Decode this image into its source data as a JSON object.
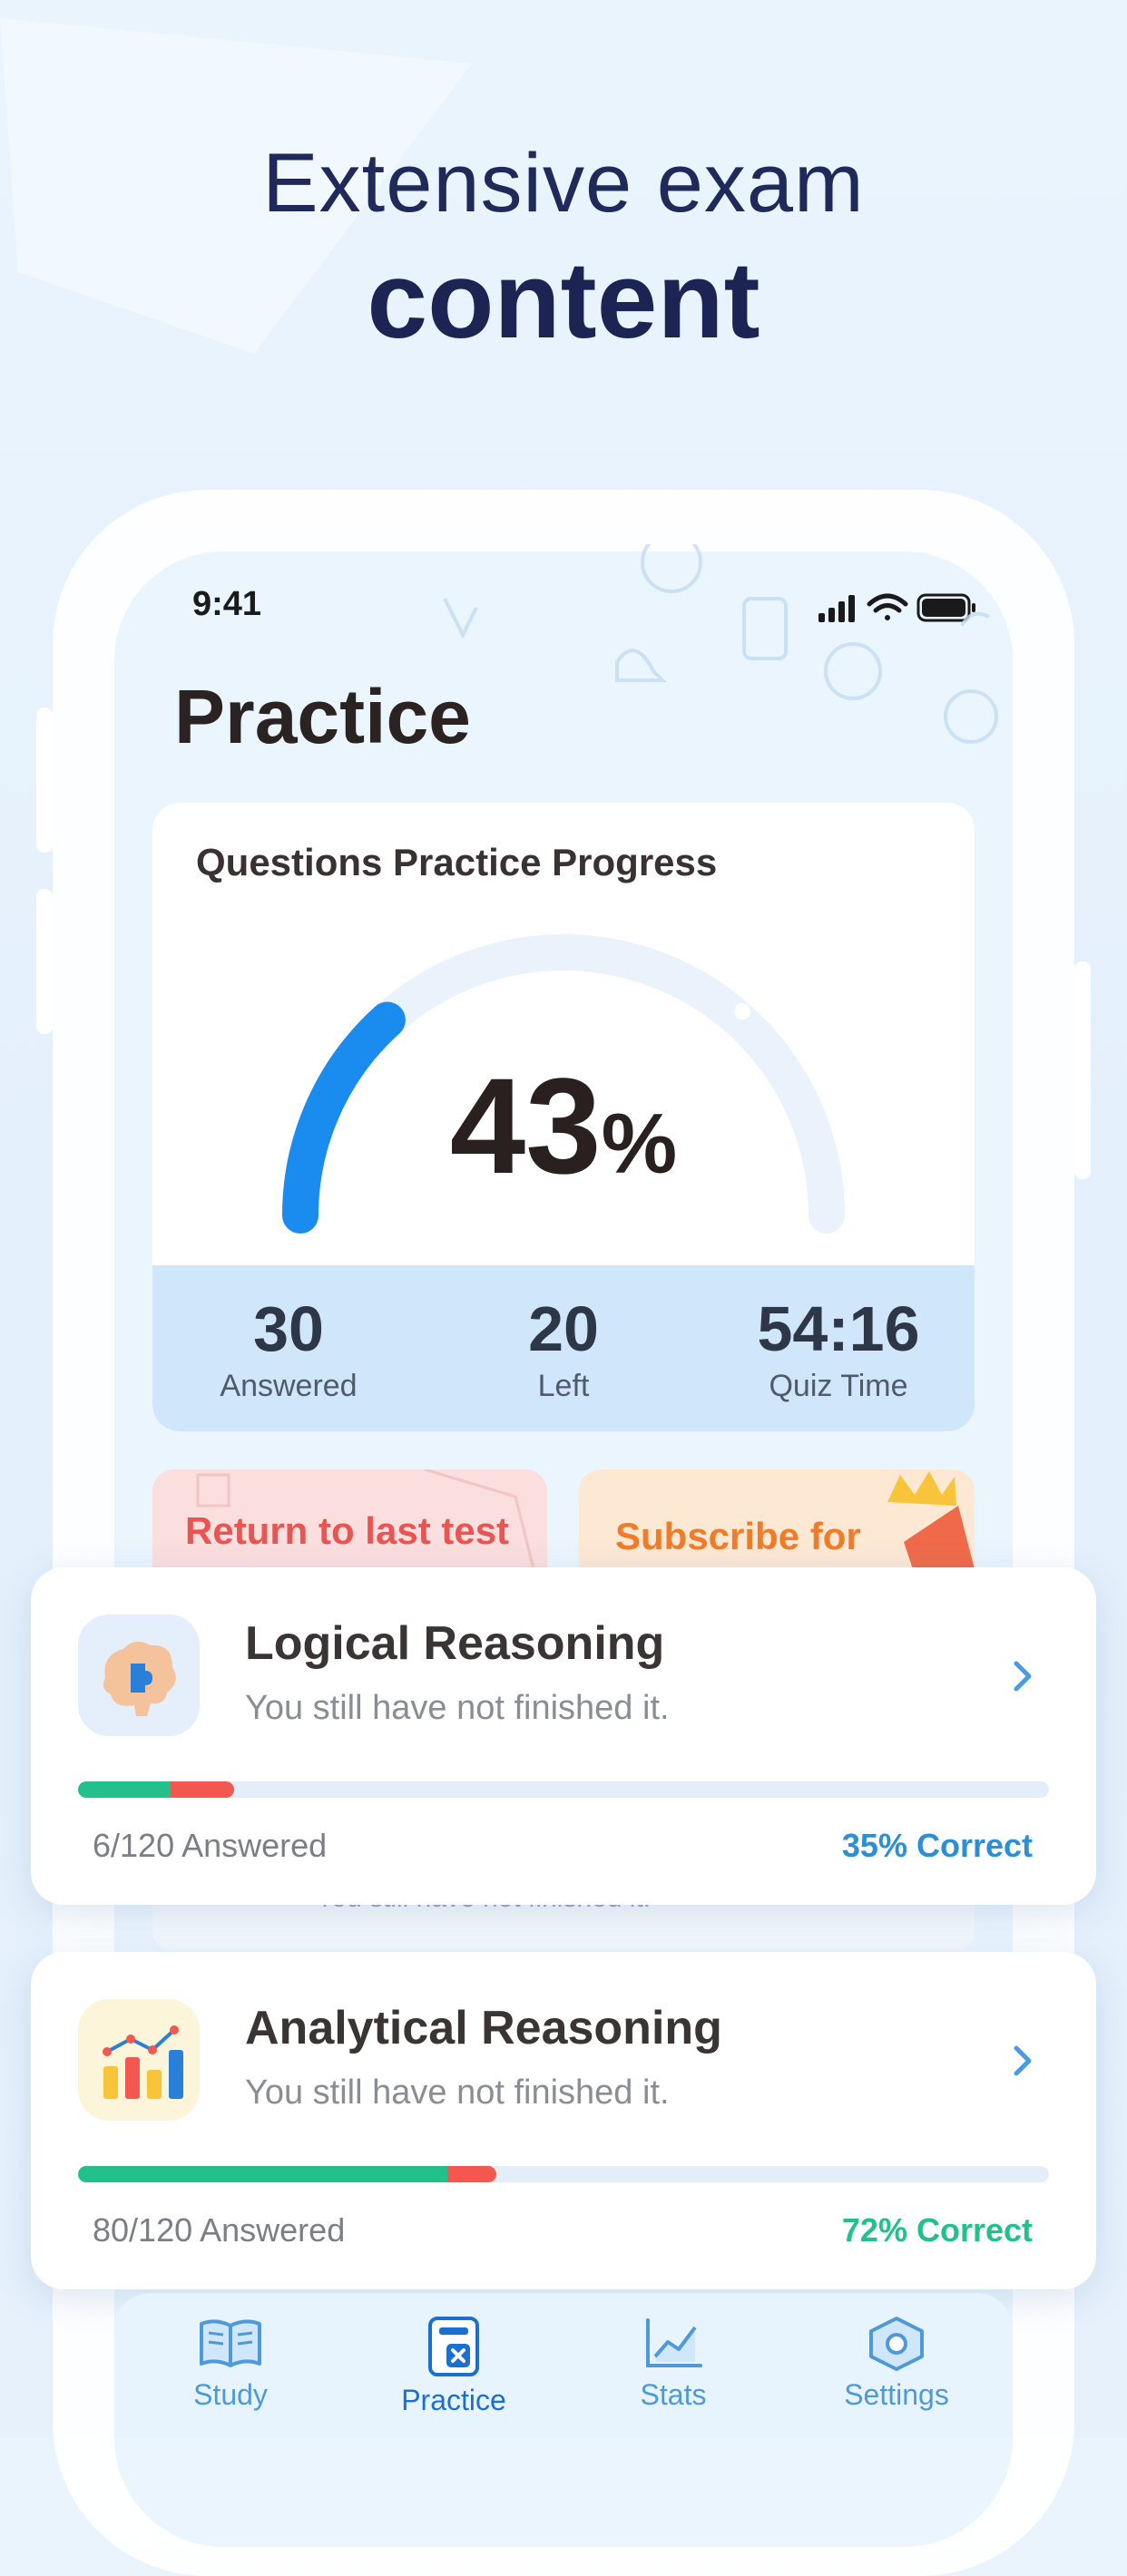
{
  "headline": {
    "line1": "Extensive exam",
    "line2": "content"
  },
  "status_bar": {
    "time": "9:41"
  },
  "page": {
    "title": "Practice"
  },
  "progress_card": {
    "title": "Questions Practice Progress",
    "percent": "43",
    "percent_symbol": "%",
    "progress_fraction": 0.43,
    "stats": [
      {
        "value": "30",
        "label": "Answered"
      },
      {
        "value": "20",
        "label": "Left"
      },
      {
        "value": "54:16",
        "label": "Quiz Time"
      }
    ]
  },
  "actions": {
    "return_label": "Return to last test",
    "subscribe_label": "Subscribe for"
  },
  "hidden_row": {
    "subtitle": "You still have not finished it."
  },
  "topics": [
    {
      "title": "Logical Reasoning",
      "subtitle": "You still have not finished it.",
      "answered": "6/120 Answered",
      "correct": "35% Correct",
      "correct_color": "#2a8fd6",
      "green_fraction": 0.095,
      "red_fraction": 0.065,
      "icon": "brain-puzzle-icon"
    },
    {
      "title": "Analytical Reasoning",
      "subtitle": "You still have not finished it.",
      "answered": "80/120 Answered",
      "correct": "72% Correct",
      "correct_color": "#22c08b",
      "green_fraction": 0.38,
      "red_fraction": 0.05,
      "icon": "bar-chart-icon"
    }
  ],
  "tabs": [
    {
      "label": "Study",
      "icon": "book-icon"
    },
    {
      "label": "Practice",
      "icon": "practice-card-icon",
      "active": true
    },
    {
      "label": "Stats",
      "icon": "chart-line-icon"
    },
    {
      "label": "Settings",
      "icon": "gear-icon"
    }
  ],
  "colors": {
    "accent_blue": "#1a8cf0",
    "progress_green": "#22c08b",
    "progress_red": "#f2584f",
    "headline": "#1b2453"
  }
}
